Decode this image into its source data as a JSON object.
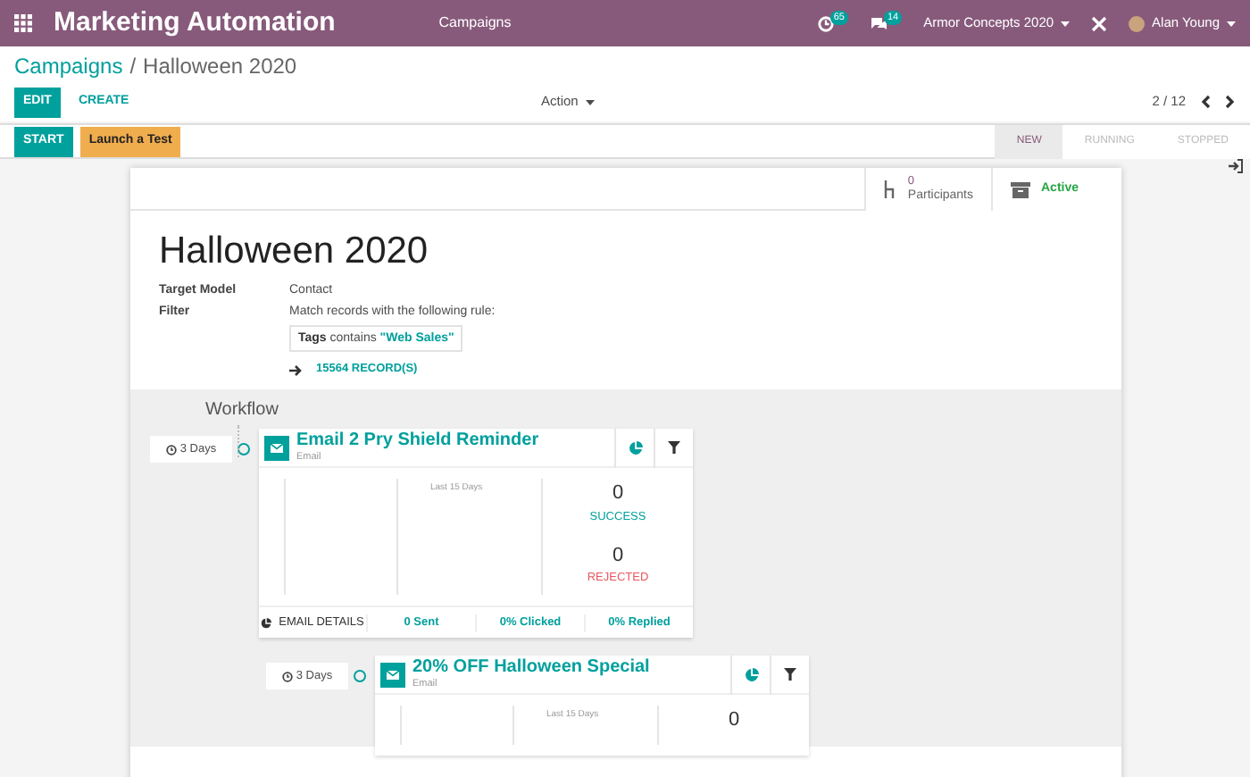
{
  "navbar": {
    "app_title": "Marketing Automation",
    "menu": [
      {
        "label": "Campaigns"
      }
    ],
    "activity_count": "65",
    "message_count": "14",
    "company": "Armor Concepts 2020",
    "user": "Alan Young"
  },
  "breadcrumb": [
    {
      "label": "Campaigns"
    },
    {
      "label": "Halloween 2020"
    }
  ],
  "breadcrumb_separator": "/",
  "control_panel": {
    "buttons": [
      {
        "label": "EDIT",
        "kind": "primary"
      },
      {
        "label": "CREATE",
        "kind": "link"
      }
    ],
    "action": "Action",
    "pager": "2 / 12"
  },
  "status_bar": {
    "buttons": [
      {
        "label": "START",
        "kind": "primary"
      },
      {
        "label": "Launch a Test",
        "kind": "warning"
      }
    ],
    "stages": [
      {
        "label": "NEW",
        "selected": true
      },
      {
        "label": "RUNNING",
        "selected": false
      },
      {
        "label": "STOPPED",
        "selected": false
      }
    ]
  },
  "sheet": {
    "stat_buttons": [
      {
        "kind": "participants",
        "value": "0",
        "label": "Participants"
      },
      {
        "kind": "active",
        "label": "Active"
      }
    ],
    "title": "Halloween 2020",
    "fields": [
      {
        "label": "Target Model",
        "value": "Contact"
      },
      {
        "label": "Filter",
        "value": "Match records with the following rule:"
      }
    ],
    "rule": {
      "field": "Tags",
      "operator": "contains",
      "value": "\"Web Sales\""
    },
    "records_link": "15564 RECORD(S)"
  },
  "workflow": {
    "title": "Workflow",
    "activities": [
      {
        "interval": "3 Days",
        "name": "Email 2 Pry Shield Reminder",
        "type": "Email",
        "chart_caption": "Last 15 Days",
        "success": "0",
        "success_label": "SUCCESS",
        "rejected": "0",
        "rejected_label": "REJECTED",
        "details": "EMAIL DETAILS",
        "stats": [
          "0 Sent",
          "0% Clicked",
          "0% Replied"
        ]
      },
      {
        "interval": "3 Days",
        "name": "20% OFF Halloween Special",
        "type": "Email",
        "chart_caption": "Last 15 Days",
        "success": "0"
      }
    ]
  }
}
